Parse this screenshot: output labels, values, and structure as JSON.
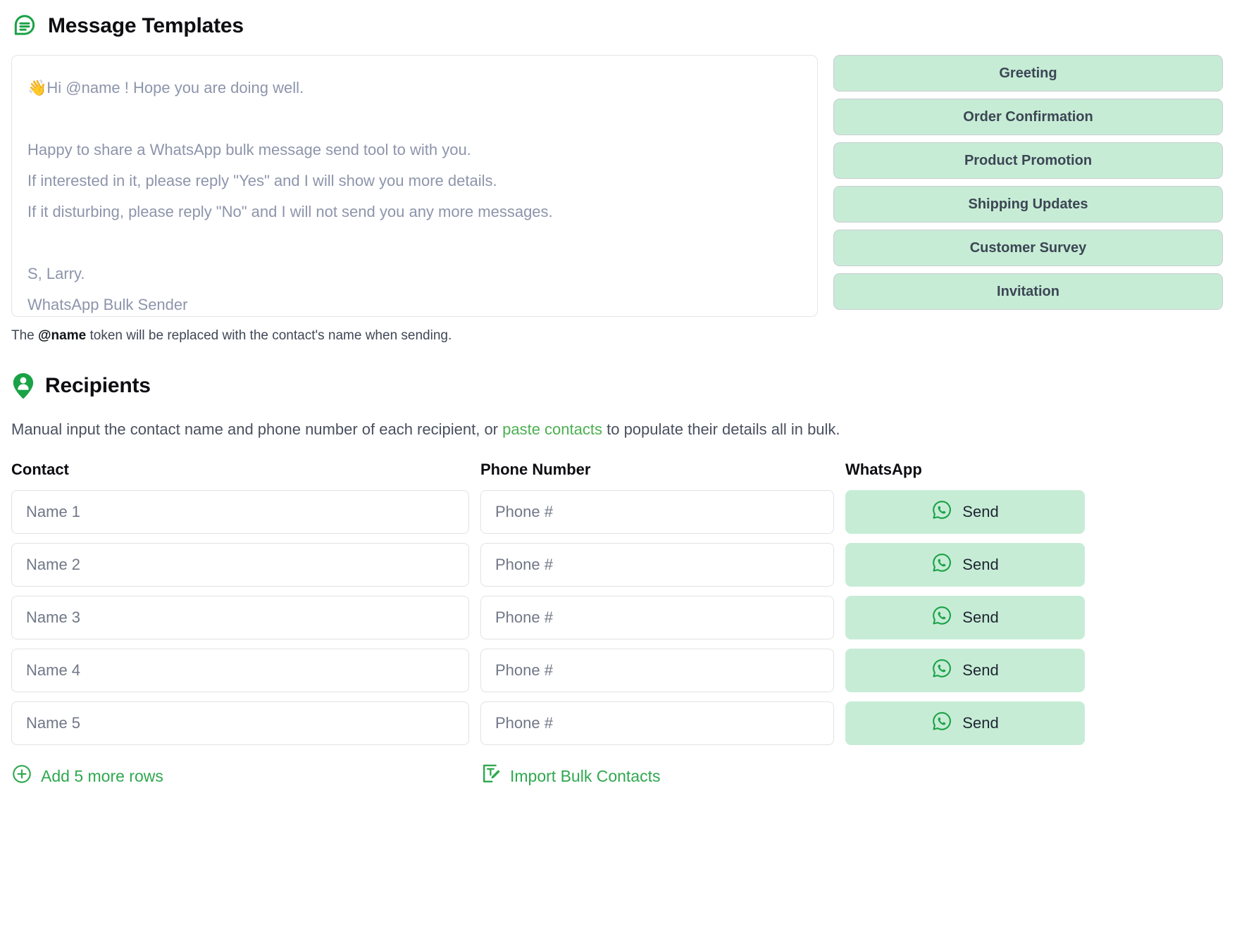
{
  "templates_section": {
    "icon": "message-lines-icon",
    "title": "Message Templates",
    "message_body": "👋Hi @name ! Hope you are doing well.\n\nHappy to share a WhatsApp bulk message send tool to with you.\nIf interested in it, please reply \"Yes\" and I will show you more details.\nIf it disturbing, please reply \"No\" and I will not send you any more messages.\n\nS, Larry.\nWhatsApp Bulk Sender",
    "template_buttons": [
      {
        "label": "Greeting"
      },
      {
        "label": "Order Confirmation"
      },
      {
        "label": "Product Promotion"
      },
      {
        "label": "Shipping Updates"
      },
      {
        "label": "Customer Survey"
      },
      {
        "label": "Invitation"
      }
    ],
    "hint": {
      "before": "The ",
      "token": "@name",
      "after": " token will be replaced with the contact's name when sending."
    }
  },
  "recipients_section": {
    "icon": "user-pin-icon",
    "title": "Recipients",
    "description": {
      "before": "Manual input the contact name and phone number of each recipient, or ",
      "link": "paste contacts",
      "after": " to populate their details all in bulk."
    },
    "columns": {
      "contact": "Contact",
      "phone": "Phone Number",
      "whatsapp": "WhatsApp"
    },
    "rows": [
      {
        "name_placeholder": "Name 1",
        "phone_placeholder": "Phone #",
        "send_label": "Send"
      },
      {
        "name_placeholder": "Name 2",
        "phone_placeholder": "Phone #",
        "send_label": "Send"
      },
      {
        "name_placeholder": "Name 3",
        "phone_placeholder": "Phone #",
        "send_label": "Send"
      },
      {
        "name_placeholder": "Name 4",
        "phone_placeholder": "Phone #",
        "send_label": "Send"
      },
      {
        "name_placeholder": "Name 5",
        "phone_placeholder": "Phone #",
        "send_label": "Send"
      }
    ],
    "add_rows_label": "Add 5 more rows",
    "import_label": "Import Bulk Contacts"
  },
  "colors": {
    "brand_green": "#2fa84f",
    "link_green": "#4caf50",
    "button_green_bg": "#c7ecd6",
    "placeholder_grey": "#707786",
    "message_text": "#8d95ab"
  }
}
